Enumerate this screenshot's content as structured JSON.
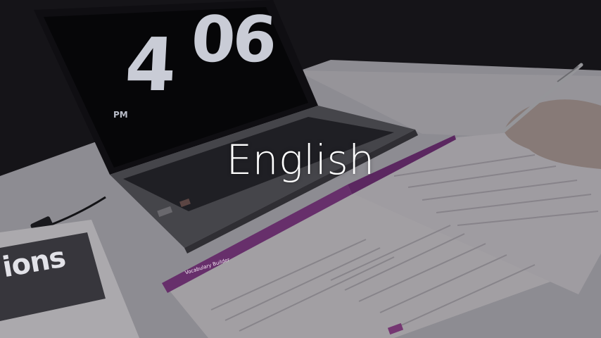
{
  "caption": "English",
  "laptop_clock": {
    "hour": "4",
    "minutes": "06",
    "period": "PM"
  },
  "textbook_cover_word": "ions",
  "workbook_section_title": "Vocabulary Builder",
  "colors": {
    "background": "#1c1a1f",
    "desk": "#c4c2c9",
    "workbook_accent": "#8a3f8f",
    "caption_text": "#ffffff"
  }
}
